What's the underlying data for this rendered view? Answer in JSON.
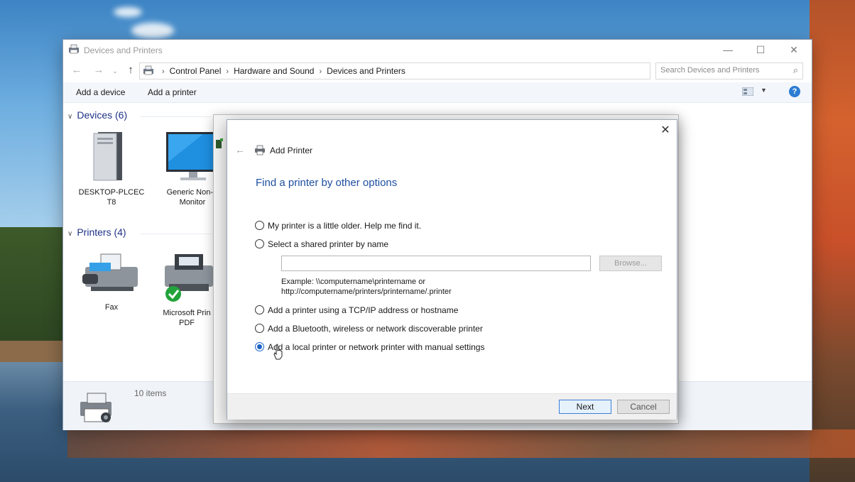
{
  "window": {
    "title": "Devices and Printers",
    "minimize": "—",
    "maximize": "☐",
    "close": "✕"
  },
  "nav": {
    "back": "←",
    "forward": "→",
    "up": "↑",
    "breadcrumbs": [
      "Control Panel",
      "Hardware and Sound",
      "Devices and Printers"
    ],
    "separator": "›",
    "dropdown": "⌵",
    "refresh": "↻"
  },
  "search": {
    "placeholder": "Search Devices and Printers",
    "icon": "⌕"
  },
  "toolbar": {
    "add_device": "Add a device",
    "add_printer": "Add a printer",
    "help": "?"
  },
  "devices": {
    "header": "Devices (6)",
    "items": [
      {
        "line1": "DESKTOP-PLCEC",
        "line2": "T8"
      },
      {
        "line1": "Generic Non-P",
        "line2": "Monitor"
      }
    ]
  },
  "printers": {
    "header": "Printers (4)",
    "items": [
      {
        "line1": "Fax",
        "line2": ""
      },
      {
        "line1": "Microsoft Prin",
        "line2": "PDF"
      }
    ]
  },
  "status": {
    "item_count": "10 items"
  },
  "dialog": {
    "close": "✕",
    "back": "←",
    "title": "Add Printer",
    "heading": "Find a printer by other options",
    "options": [
      {
        "label": "My printer is a little older. Help me find it.",
        "selected": false
      },
      {
        "label": "Select a shared printer by name",
        "selected": false
      },
      {
        "label": "Add a printer using a TCP/IP address or hostname",
        "selected": false
      },
      {
        "label": "Add a Bluetooth, wireless or network discoverable printer",
        "selected": false
      },
      {
        "label": "Add a local printer or network printer with manual settings",
        "selected": true
      }
    ],
    "shared_name_value": "",
    "browse": "Browse...",
    "example_line1": "Example: \\\\computername\\printername or",
    "example_line2": "http://computername/printers/printername/.printer",
    "next": "Next",
    "cancel": "Cancel"
  },
  "colors": {
    "group_header": "#1e3287",
    "dialog_heading": "#1e4fa0",
    "accent": "#1c63c8",
    "help": "#2b7cd3",
    "check": "#22a33a"
  }
}
